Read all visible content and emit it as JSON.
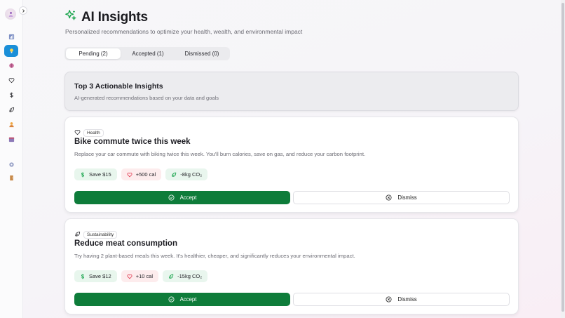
{
  "header": {
    "title": "AI Insights",
    "title_icon": "sparkles-icon",
    "subtitle": "Personalized recommendations to optimize your health, wealth, and environmental impact"
  },
  "sidebar": {
    "items": [
      {
        "icon": "dashboard-icon"
      },
      {
        "icon": "lightbulb-icon",
        "active": true
      },
      {
        "icon": "brain-icon"
      },
      {
        "icon": "heart-icon"
      },
      {
        "icon": "dollar-icon"
      },
      {
        "icon": "leaf-icon"
      },
      {
        "icon": "person-icon"
      },
      {
        "icon": "calendar-icon"
      },
      {
        "icon": "settings-icon"
      },
      {
        "icon": "door-icon"
      }
    ]
  },
  "tabs": [
    {
      "label": "Pending (2)",
      "active": true
    },
    {
      "label": "Accepted (1)"
    },
    {
      "label": "Dismissed (0)"
    }
  ],
  "intro": {
    "title": "Top 3 Actionable Insights",
    "subtitle": "AI-generated recommendations based on your data and goals"
  },
  "insights": [
    {
      "category": "Health",
      "category_icon": "heart-icon",
      "title": "Bike commute twice this week",
      "description": "Replace your car commute with biking twice this week. You'll burn calories, save on gas, and reduce your carbon footprint.",
      "metrics": {
        "money": "Save $15",
        "health": "+500 cal",
        "env": "-8kg CO₂"
      },
      "accept_label": "Accept",
      "dismiss_label": "Dismiss"
    },
    {
      "category": "Sustainability",
      "category_icon": "leaf-icon",
      "title": "Reduce meat consumption",
      "description": "Try having 2 plant-based meals this week. It's healthier, cheaper, and significantly reduces your environmental impact.",
      "metrics": {
        "money": "Save $12",
        "health": "+10 cal",
        "env": "-15kg CO₂"
      },
      "accept_label": "Accept",
      "dismiss_label": "Dismiss"
    }
  ],
  "colors": {
    "accent": "#0e7c3a",
    "sidebar_active": "#1a8fd8",
    "money_bg": "#e8f6ed",
    "health_bg": "#fdeced",
    "env_bg": "#e9f6ee"
  }
}
